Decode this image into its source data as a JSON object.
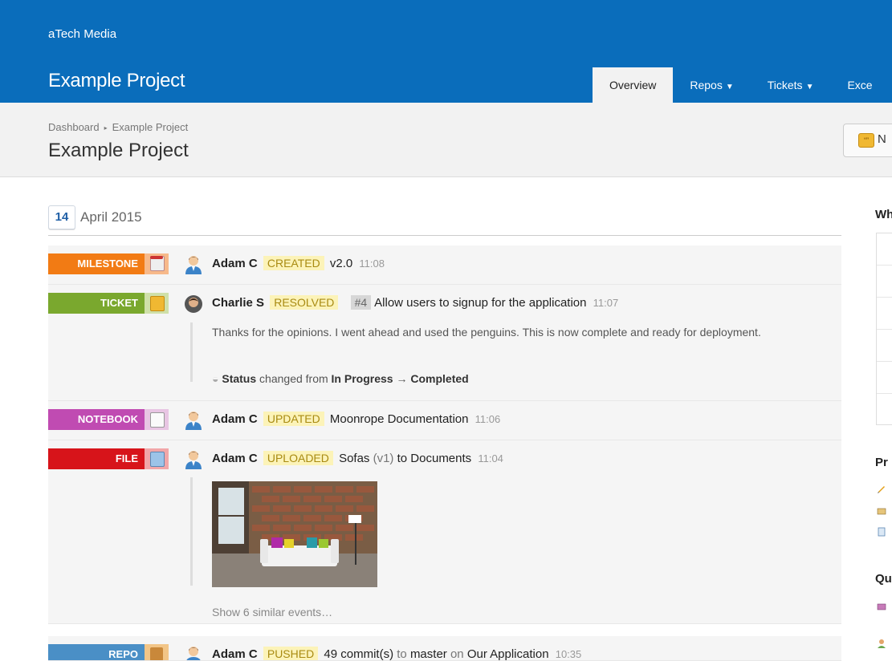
{
  "header": {
    "org": "aTech Media",
    "project": "Example Project",
    "tabs": [
      {
        "label": "Overview",
        "active": true
      },
      {
        "label": "Repos",
        "active": false
      },
      {
        "label": "Tickets",
        "active": false
      },
      {
        "label": "Exce",
        "active": false
      }
    ]
  },
  "subheader": {
    "breadcrumb": [
      "Dashboard",
      "Example Project"
    ],
    "title": "Example Project",
    "new_button_label": "N"
  },
  "feed": {
    "day": "14",
    "month_year": "April 2015",
    "events": [
      {
        "type": "MILESTONE",
        "color": "#f27b14",
        "icon": "calendar-icon",
        "user": "Adam C",
        "verb": "CREATED",
        "object": "v2.0",
        "time": "11:08"
      },
      {
        "type": "TICKET",
        "color": "#7aa82e",
        "icon": "speech-bubble-icon",
        "user": "Charlie S",
        "verb": "RESOLVED",
        "ticket_number": "#4",
        "object": "Allow users to signup for the application",
        "time": "11:07",
        "comment": "Thanks for the opinions. I went ahead and used the penguins. This is now complete and ready for deployment.",
        "status_label": "Status",
        "status_changed": "changed from",
        "status_from": "In Progress",
        "status_arrow": "→",
        "status_to": "Completed"
      },
      {
        "type": "NOTEBOOK",
        "color": "#c04bb2",
        "icon": "notebook-icon",
        "user": "Adam C",
        "verb": "UPDATED",
        "object": "Moonrope Documentation",
        "time": "11:06"
      },
      {
        "type": "FILE",
        "color": "#d7141a",
        "icon": "upload-icon",
        "user": "Adam C",
        "verb": "UPLOADED",
        "object": "Sofas",
        "version": "(v1)",
        "connector": "to",
        "target": "Documents",
        "time": "11:04",
        "similar": "Show 6 similar events…"
      },
      {
        "type": "REPO",
        "color": "#4a8fc6",
        "icon": "repo-icon",
        "user": "Adam C",
        "verb": "PUSHED",
        "object": "49 commit(s)",
        "connector1": "to",
        "branch": "master",
        "connector2": "on",
        "repo": "Our Application",
        "time": "10:35"
      }
    ]
  },
  "sidebar": {
    "heading1": "Wh",
    "heading2": "Pr",
    "heading3": "Qu"
  }
}
